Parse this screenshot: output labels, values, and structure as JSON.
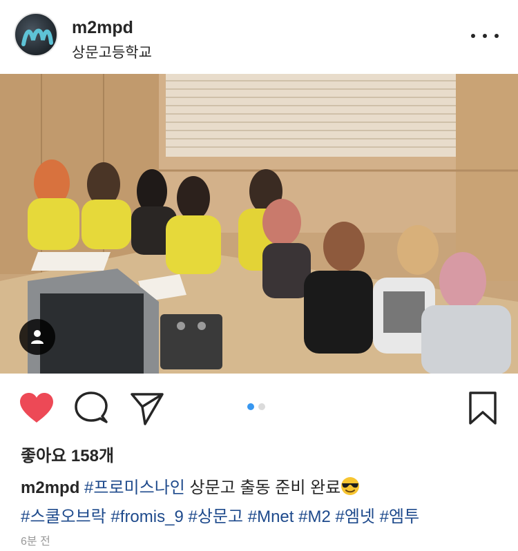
{
  "header": {
    "username": "m2mpd",
    "location": "상문고등학교"
  },
  "post": {
    "media_index": 1,
    "media_count": 2
  },
  "likes": {
    "text": "좋아요 158개"
  },
  "caption": {
    "username": "m2mpd",
    "hashtag1": "#프로미스나인",
    "text": "상문고 출동 준비 완료",
    "emoji": "sunglasses-face",
    "hashtags": [
      "#스쿨오브락",
      "#fromis_9",
      "#상문고",
      "#Mnet",
      "#M2",
      "#엠넷",
      "#엠투"
    ]
  },
  "time": "6분 전",
  "colors": {
    "like_red": "#ed4956",
    "dot_active": "#3897f0",
    "dot_inactive": "#dbdbdb",
    "hashtag": "#1e4a8c"
  },
  "icons": {
    "more": "more-horizontal-icon",
    "like": "heart-filled-icon",
    "comment": "comment-bubble-icon",
    "share": "paper-plane-icon",
    "save": "bookmark-icon",
    "tag": "user-tag-icon"
  }
}
